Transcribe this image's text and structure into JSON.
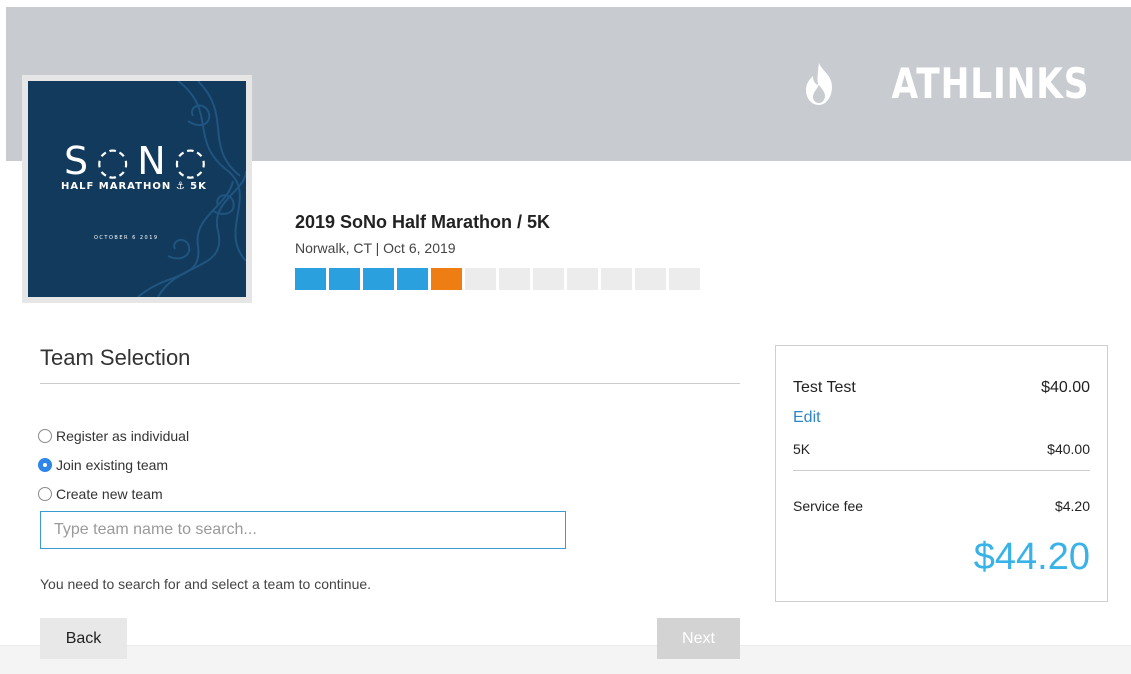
{
  "brand": {
    "name": "ATHLINKS"
  },
  "event_logo": {
    "title": "S◌N◌",
    "subtitle": "HALF MARATHON ⚓ 5K",
    "date": "OCTOBER 6 2019"
  },
  "event": {
    "title": "2019 SoNo Half Marathon / 5K",
    "location_date": "Norwalk, CT | Oct 6, 2019",
    "progress": {
      "total_steps": 12,
      "completed_steps": 4,
      "current_step": 5
    }
  },
  "team_selection": {
    "title": "Team Selection",
    "options": [
      {
        "label": "Register as individual",
        "checked": false
      },
      {
        "label": "Join existing team",
        "checked": true
      },
      {
        "label": "Create new team",
        "checked": false
      }
    ],
    "search": {
      "placeholder": "Type team name to search...",
      "value": ""
    },
    "hint": "You need to search for and select a team to continue."
  },
  "buttons": {
    "back": "Back",
    "next": "Next"
  },
  "summary": {
    "registrant_name": "Test Test",
    "registrant_amount": "$40.00",
    "edit_label": "Edit",
    "item_label": "5K",
    "item_amount": "$40.00",
    "fee_label": "Service fee",
    "fee_amount": "$4.20",
    "total": "$44.20"
  },
  "colors": {
    "header_band": "#c8ccd1",
    "progress_done": "#2aa0de",
    "progress_current": "#ee7d14",
    "progress_pending": "#ececec",
    "total": "#39b2e8",
    "link": "#2f86c6",
    "radio_checked": "#2f86e8"
  }
}
